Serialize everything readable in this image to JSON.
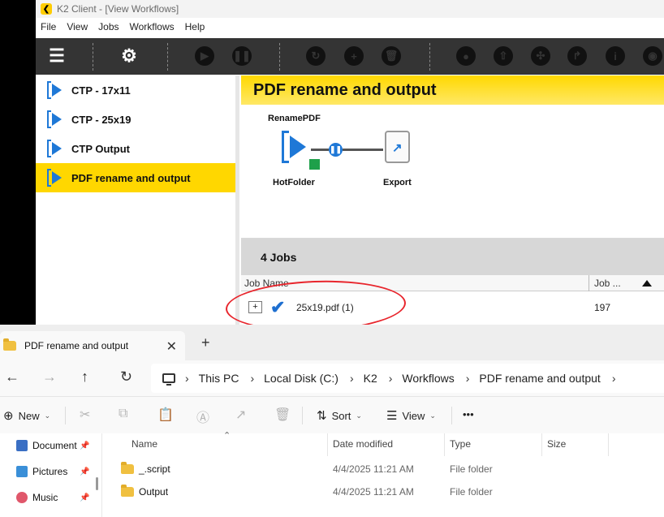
{
  "k2": {
    "title": "K2 Client - [View Workflows]",
    "logo_glyph": "❮",
    "menu": [
      "File",
      "View",
      "Jobs",
      "Workflows",
      "Help"
    ],
    "toolbar_icons": [
      "menu-icon",
      "settings-icon",
      "play-icon",
      "pause-icon",
      "refresh-icon",
      "add-icon",
      "delete-icon",
      "ink-icon",
      "upload-icon",
      "layout-icon",
      "redirect-icon",
      "info-icon",
      "view-icon"
    ],
    "workflows": [
      {
        "label": "CTP - 17x11",
        "selected": false
      },
      {
        "label": "CTP - 25x19",
        "selected": false
      },
      {
        "label": "CTP Output",
        "selected": false
      },
      {
        "label": "PDF rename and output",
        "selected": true
      }
    ],
    "workflow_title": "PDF rename and output",
    "diagram": {
      "group_label": "RenamePDF",
      "source_label": "HotFolder",
      "target_label": "Export"
    },
    "jobs": {
      "count_label": "4 Jobs",
      "col_name": "Job Name",
      "col_num": "Job ...",
      "rows": [
        {
          "expander": "+",
          "name": "25x19.pdf (1)",
          "num": "197"
        }
      ]
    },
    "colors": {
      "accent": "#ffd700",
      "blue": "#1e78d7",
      "annotation": "#e8252c"
    }
  },
  "explorer": {
    "tab_title": "PDF rename and output",
    "tab_close": "✕",
    "tab_add": "+",
    "nav": {
      "back": "←",
      "forward": "→",
      "up": "↑",
      "refresh": "↻"
    },
    "breadcrumb": [
      "This PC",
      "Local Disk (C:)",
      "K2",
      "Workflows",
      "PDF rename and output"
    ],
    "breadcrumb_sep": "›",
    "commands": {
      "new": "New",
      "sort": "Sort",
      "view": "View",
      "more": "•••"
    },
    "quick_access": [
      {
        "label": "Document",
        "icon": "documents-icon",
        "color": "#3a6fc4"
      },
      {
        "label": "Pictures",
        "icon": "pictures-icon",
        "color": "#3a8fd8"
      },
      {
        "label": "Music",
        "icon": "music-icon",
        "color": "#e0576b"
      }
    ],
    "columns": {
      "name": "Name",
      "date": "Date modified",
      "type": "Type",
      "size": "Size"
    },
    "files": [
      {
        "name": "_.script",
        "date": "4/4/2025 11:21 AM",
        "type": "File folder"
      },
      {
        "name": "Output",
        "date": "4/4/2025 11:21 AM",
        "type": "File folder"
      }
    ]
  }
}
